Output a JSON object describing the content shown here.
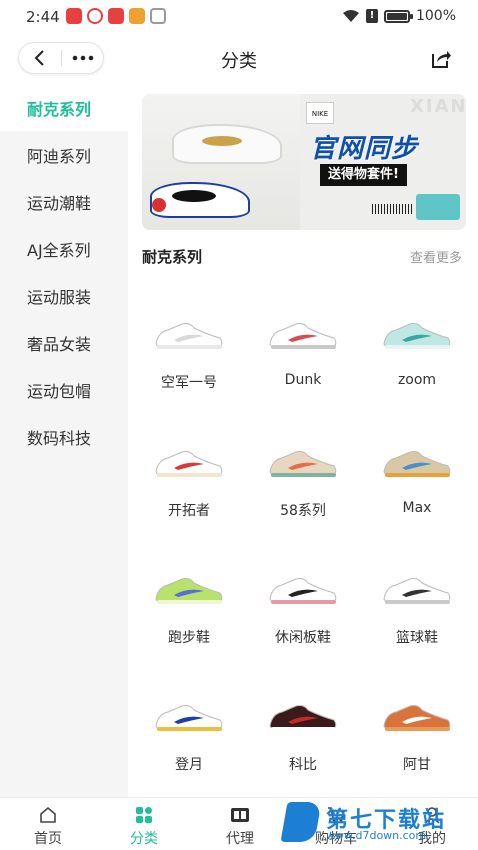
{
  "status": {
    "time": "2:44",
    "battery": "100%",
    "battery_level": 1.0
  },
  "header": {
    "title": "分类",
    "back_icon": "chevron-left-icon",
    "more_icon": "more-dots-icon",
    "share_icon": "share-icon"
  },
  "sidebar": {
    "items": [
      {
        "label": "耐克系列",
        "active": true
      },
      {
        "label": "阿迪系列"
      },
      {
        "label": "运动潮鞋"
      },
      {
        "label": "AJ全系列"
      },
      {
        "label": "运动服装"
      },
      {
        "label": "奢品女装"
      },
      {
        "label": "运动包帽"
      },
      {
        "label": "数码科技"
      }
    ]
  },
  "banner": {
    "title": "官网同步",
    "subtitle": "送得物套件!",
    "watermark": "XIANSHI"
  },
  "section": {
    "title": "耐克系列",
    "more": "查看更多"
  },
  "products": [
    {
      "label": "空军一号",
      "colors": [
        "#ffffff",
        "#d9d9d9",
        "#e9e9e9"
      ]
    },
    {
      "label": "Dunk",
      "colors": [
        "#ffffff",
        "#d45050",
        "#c9c9c9"
      ]
    },
    {
      "label": "zoom",
      "colors": [
        "#bfe8e4",
        "#3aa8a0",
        "#e6f5f3"
      ]
    },
    {
      "label": "开拓者",
      "colors": [
        "#ffffff",
        "#d93a36",
        "#f2e6d0"
      ]
    },
    {
      "label": "58系列",
      "colors": [
        "#e8d6c0",
        "#e0704c",
        "#7fb3a0"
      ]
    },
    {
      "label": "Max",
      "colors": [
        "#d9c8a4",
        "#4c8ec7",
        "#e8a13a"
      ]
    },
    {
      "label": "跑步鞋",
      "colors": [
        "#b8e26a",
        "#5a6ed8",
        "#eef6d8"
      ]
    },
    {
      "label": "休闲板鞋",
      "colors": [
        "#ffffff",
        "#222222",
        "#e89aa2"
      ]
    },
    {
      "label": "篮球鞋",
      "colors": [
        "#ffffff",
        "#333333",
        "#c9c9c9"
      ]
    },
    {
      "label": "登月",
      "colors": [
        "#ffffff",
        "#1c3fa8",
        "#e8c23a"
      ]
    },
    {
      "label": "科比",
      "colors": [
        "#3a1a1a",
        "#c42a2a",
        "#ffffff"
      ]
    },
    {
      "label": "阿甘",
      "colors": [
        "#d9733a",
        "#ffffff",
        "#e89a5a"
      ]
    }
  ],
  "tabbar": {
    "tabs": [
      {
        "label": "首页",
        "icon": "home-icon"
      },
      {
        "label": "分类",
        "icon": "category-icon",
        "active": true
      },
      {
        "label": "代理",
        "icon": "recruit-icon"
      },
      {
        "label": "购物车",
        "icon": "cart-icon"
      },
      {
        "label": "我的",
        "icon": "user-icon"
      }
    ]
  },
  "watermark": {
    "text": "第七下载站",
    "url": "www.d7down.com"
  },
  "colors": {
    "accent": "#1fbf9a",
    "sidebar_bg": "#f5f5f5",
    "banner_title": "#0e4fb0"
  }
}
